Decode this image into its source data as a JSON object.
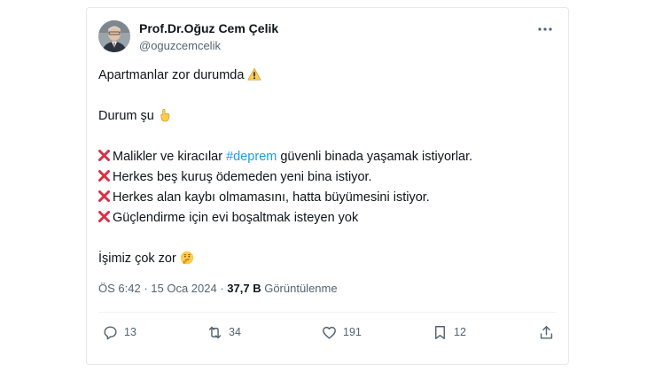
{
  "tweet": {
    "author": {
      "name": "Prof.Dr.Oğuz Cem Çelik",
      "handle": "@oguzcemcelik"
    },
    "lines": {
      "l1": "Apartmanlar zor durumda",
      "l2": "Durum şu",
      "l3_pre": "Malikler ve kiracılar ",
      "l3_tag": "#deprem",
      "l3_post": " güvenli binada yaşamak istiyorlar.",
      "l4": "Herkes beş kuruş ödemeden yeni bina istiyor.",
      "l5": "Herkes alan kaybı olmamasını, hatta büyümesini istiyor.",
      "l6": "Güçlendirme için evi boşaltmak isteyen yok",
      "l7": "İşimiz çok zor"
    },
    "meta": {
      "time": "ÖS 6:42",
      "sep": " · ",
      "date": "15 Oca 2024",
      "views_count": "37,7 B",
      "views_label": " Görüntülenme"
    },
    "actions": {
      "replies": "13",
      "retweets": "34",
      "likes": "191",
      "bookmarks": "12"
    },
    "icons": {
      "warning": "warning-icon",
      "point_down": "pointing-down-icon",
      "cross": "cross-mark-icon",
      "thinking": "thinking-face-icon"
    },
    "colors": {
      "hashtag": "#1d9bf0",
      "cross": "#dd2e44",
      "secondary_text": "#536471"
    }
  }
}
